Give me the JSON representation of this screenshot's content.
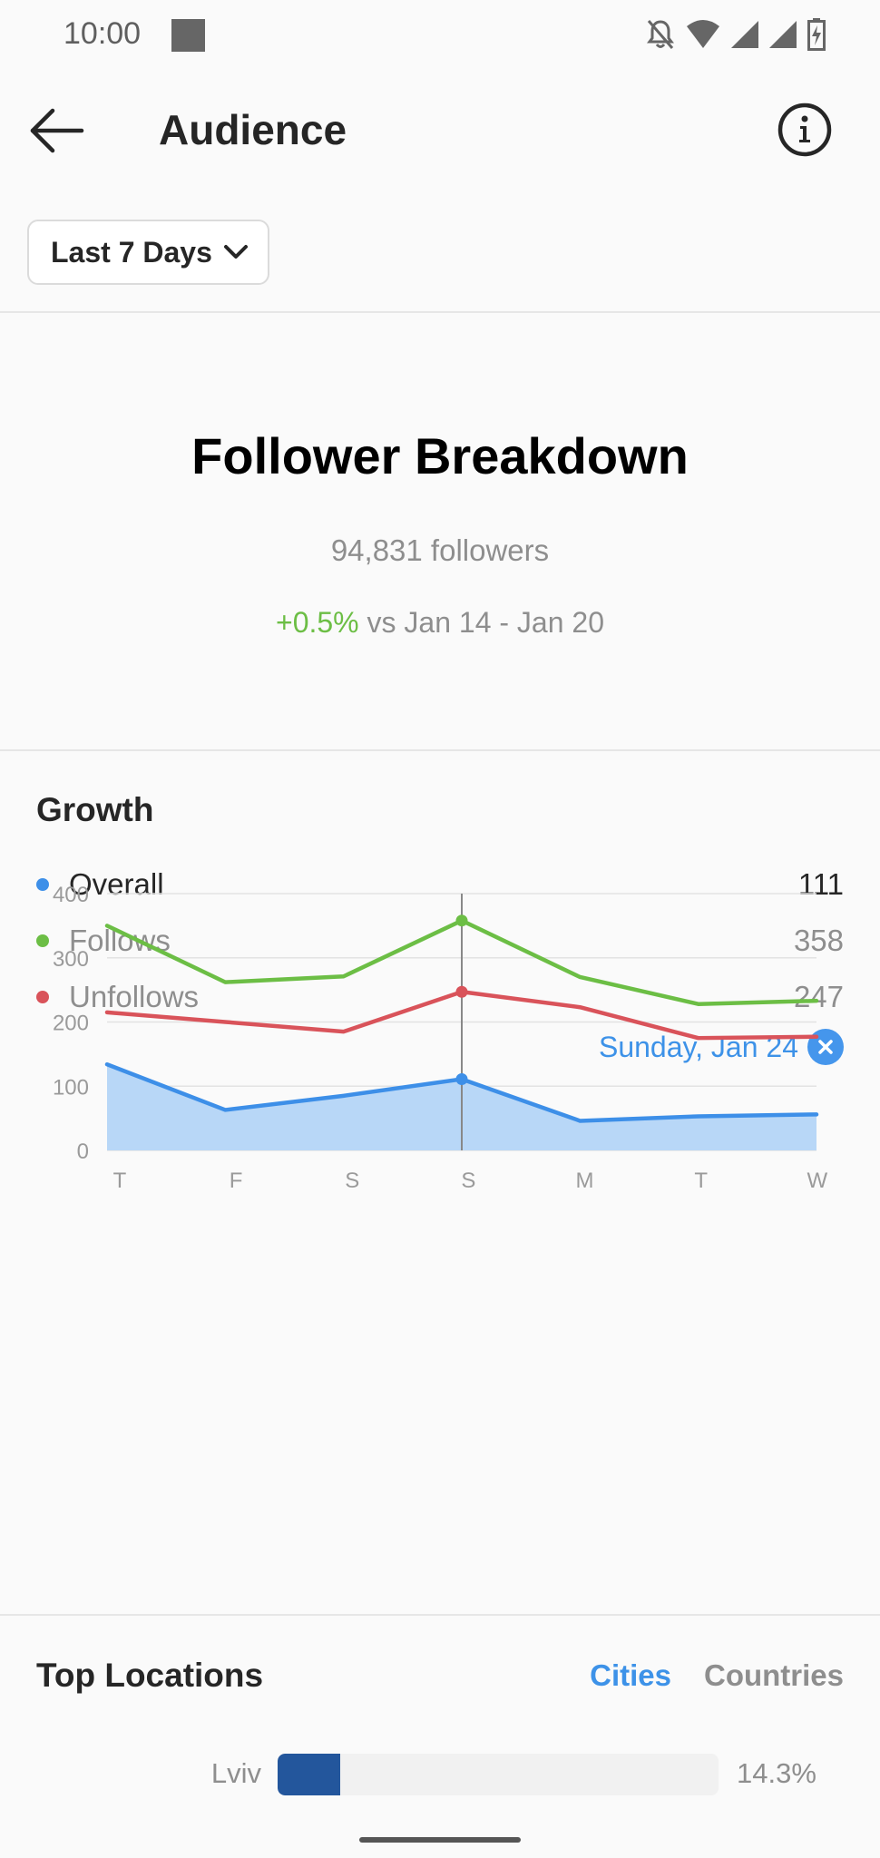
{
  "status_bar": {
    "time": "10:00",
    "icons": [
      "notifications-off-icon",
      "wifi-icon",
      "cell-signal-icon",
      "cell-signal-icon",
      "battery-charging-icon"
    ]
  },
  "app_bar": {
    "title": "Audience",
    "back_icon": "arrow-left-icon",
    "info_icon": "info-icon"
  },
  "range_selector": {
    "selected": "Last 7 Days"
  },
  "breakdown": {
    "title": "Follower Breakdown",
    "followers": "94,831 followers",
    "change": "+0.5%",
    "compare_text": "vs Jan 14 - Jan 20"
  },
  "growth": {
    "title": "Growth",
    "legend": [
      {
        "label": "Overall",
        "value": "111",
        "color": "#3d8fe8"
      },
      {
        "label": "Follows",
        "value": "358",
        "color": "#6cbe45"
      },
      {
        "label": "Unfollows",
        "value": "247",
        "color": "#d9535a"
      }
    ],
    "selected_date": "Sunday, Jan 24"
  },
  "chart_data": {
    "type": "line",
    "title": "Growth",
    "xlabel": "",
    "ylabel": "",
    "categories": [
      "T",
      "F",
      "S",
      "S",
      "M",
      "T",
      "W"
    ],
    "ylim": [
      0,
      400
    ],
    "yticks": [
      0,
      100,
      200,
      300,
      400
    ],
    "grid": true,
    "selected_index": 3,
    "series": [
      {
        "name": "Follows",
        "color": "#6cbe45",
        "values": [
          350,
          262,
          271,
          358,
          270,
          228,
          233
        ],
        "fill": false
      },
      {
        "name": "Unfollows",
        "color": "#d9535a",
        "values": [
          215,
          200,
          185,
          247,
          223,
          175,
          177
        ],
        "fill": false
      },
      {
        "name": "Overall",
        "color": "#3d8fe8",
        "values": [
          134,
          63,
          85,
          111,
          46,
          53,
          56
        ],
        "fill": true,
        "fill_color": "#b8d7f7"
      }
    ]
  },
  "top_locations": {
    "title": "Top Locations",
    "tabs": [
      {
        "label": "Cities",
        "active": true
      },
      {
        "label": "Countries",
        "active": false
      }
    ],
    "rows": [
      {
        "name": "Lviv",
        "percent_label": "14.3%",
        "fraction": 0.143
      }
    ],
    "bar_color": "#23569c"
  }
}
